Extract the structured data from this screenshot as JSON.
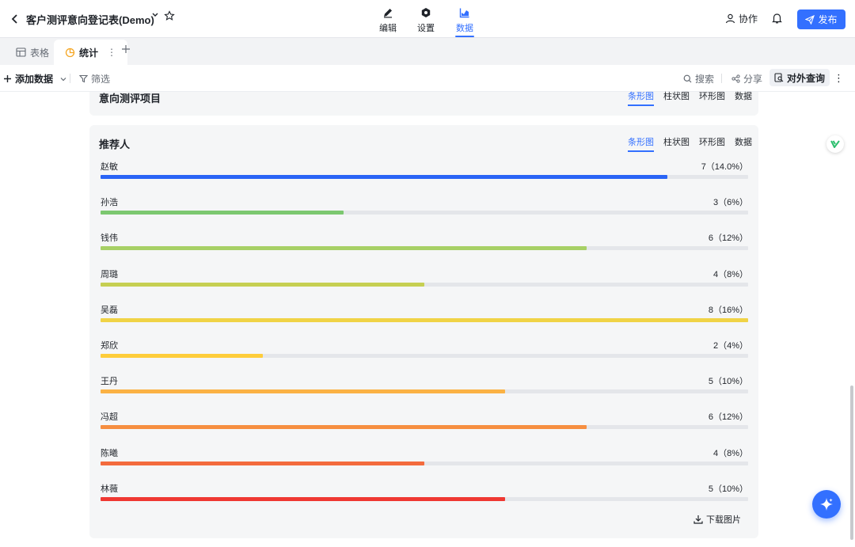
{
  "header": {
    "title": "客户测评意向登记表(Demo)",
    "modes": [
      {
        "label": "编辑",
        "icon": "pen-icon"
      },
      {
        "label": "设置",
        "icon": "gear-icon"
      },
      {
        "label": "数据",
        "icon": "chart-icon",
        "active": true
      }
    ],
    "collab_label": "协作",
    "publish_label": "发布"
  },
  "tabs": [
    {
      "label": "表格",
      "icon": "table-icon"
    },
    {
      "label": "统计",
      "icon": "pie-chart-icon",
      "active": true
    }
  ],
  "toolbar": {
    "add_data": "添加数据",
    "filter": "筛选",
    "search": "搜索",
    "share": "分享",
    "external_query": "对外查询"
  },
  "top_card": {
    "title": "意向测评项目",
    "chart_tabs": [
      "条形图",
      "柱状图",
      "环形图",
      "数据"
    ]
  },
  "card": {
    "title": "推荐人",
    "chart_tabs": [
      "条形图",
      "柱状图",
      "环形图",
      "数据"
    ],
    "download_label": "下载图片"
  },
  "colors": {
    "accent": "#3370ff",
    "bars": [
      "#2a64f6",
      "#7cc870",
      "#a7d066",
      "#c6cf52",
      "#f0d346",
      "#fecd3b",
      "#fbb244",
      "#f68e40",
      "#f36b3d",
      "#ef3832"
    ]
  },
  "chart_data": {
    "type": "bar",
    "title": "推荐人",
    "orientation": "horizontal",
    "categories": [
      "赵敏",
      "孙浩",
      "钱伟",
      "周璐",
      "吴磊",
      "郑欣",
      "王丹",
      "冯超",
      "陈曦",
      "林薇"
    ],
    "values": [
      7,
      3,
      6,
      4,
      8,
      2,
      5,
      6,
      4,
      5
    ],
    "labels": [
      "7（14.0%）",
      "3（6%）",
      "6（12%）",
      "4（8%）",
      "8（16%）",
      "2（4%）",
      "5（10%）",
      "6（12%）",
      "4（8%）",
      "5（10%）"
    ],
    "xlim": [
      0,
      8
    ]
  }
}
